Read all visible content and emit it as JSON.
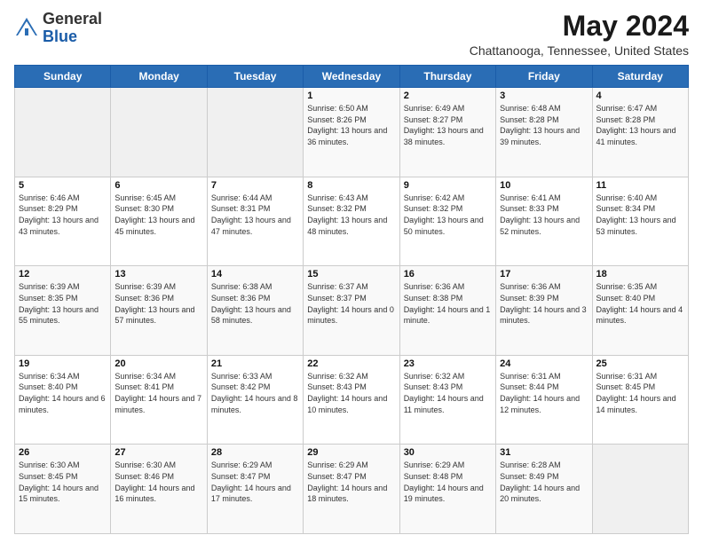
{
  "logo": {
    "general": "General",
    "blue": "Blue"
  },
  "header": {
    "month_year": "May 2024",
    "location": "Chattanooga, Tennessee, United States"
  },
  "days_of_week": [
    "Sunday",
    "Monday",
    "Tuesday",
    "Wednesday",
    "Thursday",
    "Friday",
    "Saturday"
  ],
  "weeks": [
    [
      {
        "day": "",
        "info": ""
      },
      {
        "day": "",
        "info": ""
      },
      {
        "day": "",
        "info": ""
      },
      {
        "day": "1",
        "info": "Sunrise: 6:50 AM\nSunset: 8:26 PM\nDaylight: 13 hours and 36 minutes."
      },
      {
        "day": "2",
        "info": "Sunrise: 6:49 AM\nSunset: 8:27 PM\nDaylight: 13 hours and 38 minutes."
      },
      {
        "day": "3",
        "info": "Sunrise: 6:48 AM\nSunset: 8:28 PM\nDaylight: 13 hours and 39 minutes."
      },
      {
        "day": "4",
        "info": "Sunrise: 6:47 AM\nSunset: 8:28 PM\nDaylight: 13 hours and 41 minutes."
      }
    ],
    [
      {
        "day": "5",
        "info": "Sunrise: 6:46 AM\nSunset: 8:29 PM\nDaylight: 13 hours and 43 minutes."
      },
      {
        "day": "6",
        "info": "Sunrise: 6:45 AM\nSunset: 8:30 PM\nDaylight: 13 hours and 45 minutes."
      },
      {
        "day": "7",
        "info": "Sunrise: 6:44 AM\nSunset: 8:31 PM\nDaylight: 13 hours and 47 minutes."
      },
      {
        "day": "8",
        "info": "Sunrise: 6:43 AM\nSunset: 8:32 PM\nDaylight: 13 hours and 48 minutes."
      },
      {
        "day": "9",
        "info": "Sunrise: 6:42 AM\nSunset: 8:32 PM\nDaylight: 13 hours and 50 minutes."
      },
      {
        "day": "10",
        "info": "Sunrise: 6:41 AM\nSunset: 8:33 PM\nDaylight: 13 hours and 52 minutes."
      },
      {
        "day": "11",
        "info": "Sunrise: 6:40 AM\nSunset: 8:34 PM\nDaylight: 13 hours and 53 minutes."
      }
    ],
    [
      {
        "day": "12",
        "info": "Sunrise: 6:39 AM\nSunset: 8:35 PM\nDaylight: 13 hours and 55 minutes."
      },
      {
        "day": "13",
        "info": "Sunrise: 6:39 AM\nSunset: 8:36 PM\nDaylight: 13 hours and 57 minutes."
      },
      {
        "day": "14",
        "info": "Sunrise: 6:38 AM\nSunset: 8:36 PM\nDaylight: 13 hours and 58 minutes."
      },
      {
        "day": "15",
        "info": "Sunrise: 6:37 AM\nSunset: 8:37 PM\nDaylight: 14 hours and 0 minutes."
      },
      {
        "day": "16",
        "info": "Sunrise: 6:36 AM\nSunset: 8:38 PM\nDaylight: 14 hours and 1 minute."
      },
      {
        "day": "17",
        "info": "Sunrise: 6:36 AM\nSunset: 8:39 PM\nDaylight: 14 hours and 3 minutes."
      },
      {
        "day": "18",
        "info": "Sunrise: 6:35 AM\nSunset: 8:40 PM\nDaylight: 14 hours and 4 minutes."
      }
    ],
    [
      {
        "day": "19",
        "info": "Sunrise: 6:34 AM\nSunset: 8:40 PM\nDaylight: 14 hours and 6 minutes."
      },
      {
        "day": "20",
        "info": "Sunrise: 6:34 AM\nSunset: 8:41 PM\nDaylight: 14 hours and 7 minutes."
      },
      {
        "day": "21",
        "info": "Sunrise: 6:33 AM\nSunset: 8:42 PM\nDaylight: 14 hours and 8 minutes."
      },
      {
        "day": "22",
        "info": "Sunrise: 6:32 AM\nSunset: 8:43 PM\nDaylight: 14 hours and 10 minutes."
      },
      {
        "day": "23",
        "info": "Sunrise: 6:32 AM\nSunset: 8:43 PM\nDaylight: 14 hours and 11 minutes."
      },
      {
        "day": "24",
        "info": "Sunrise: 6:31 AM\nSunset: 8:44 PM\nDaylight: 14 hours and 12 minutes."
      },
      {
        "day": "25",
        "info": "Sunrise: 6:31 AM\nSunset: 8:45 PM\nDaylight: 14 hours and 14 minutes."
      }
    ],
    [
      {
        "day": "26",
        "info": "Sunrise: 6:30 AM\nSunset: 8:45 PM\nDaylight: 14 hours and 15 minutes."
      },
      {
        "day": "27",
        "info": "Sunrise: 6:30 AM\nSunset: 8:46 PM\nDaylight: 14 hours and 16 minutes."
      },
      {
        "day": "28",
        "info": "Sunrise: 6:29 AM\nSunset: 8:47 PM\nDaylight: 14 hours and 17 minutes."
      },
      {
        "day": "29",
        "info": "Sunrise: 6:29 AM\nSunset: 8:47 PM\nDaylight: 14 hours and 18 minutes."
      },
      {
        "day": "30",
        "info": "Sunrise: 6:29 AM\nSunset: 8:48 PM\nDaylight: 14 hours and 19 minutes."
      },
      {
        "day": "31",
        "info": "Sunrise: 6:28 AM\nSunset: 8:49 PM\nDaylight: 14 hours and 20 minutes."
      },
      {
        "day": "",
        "info": ""
      }
    ]
  ]
}
